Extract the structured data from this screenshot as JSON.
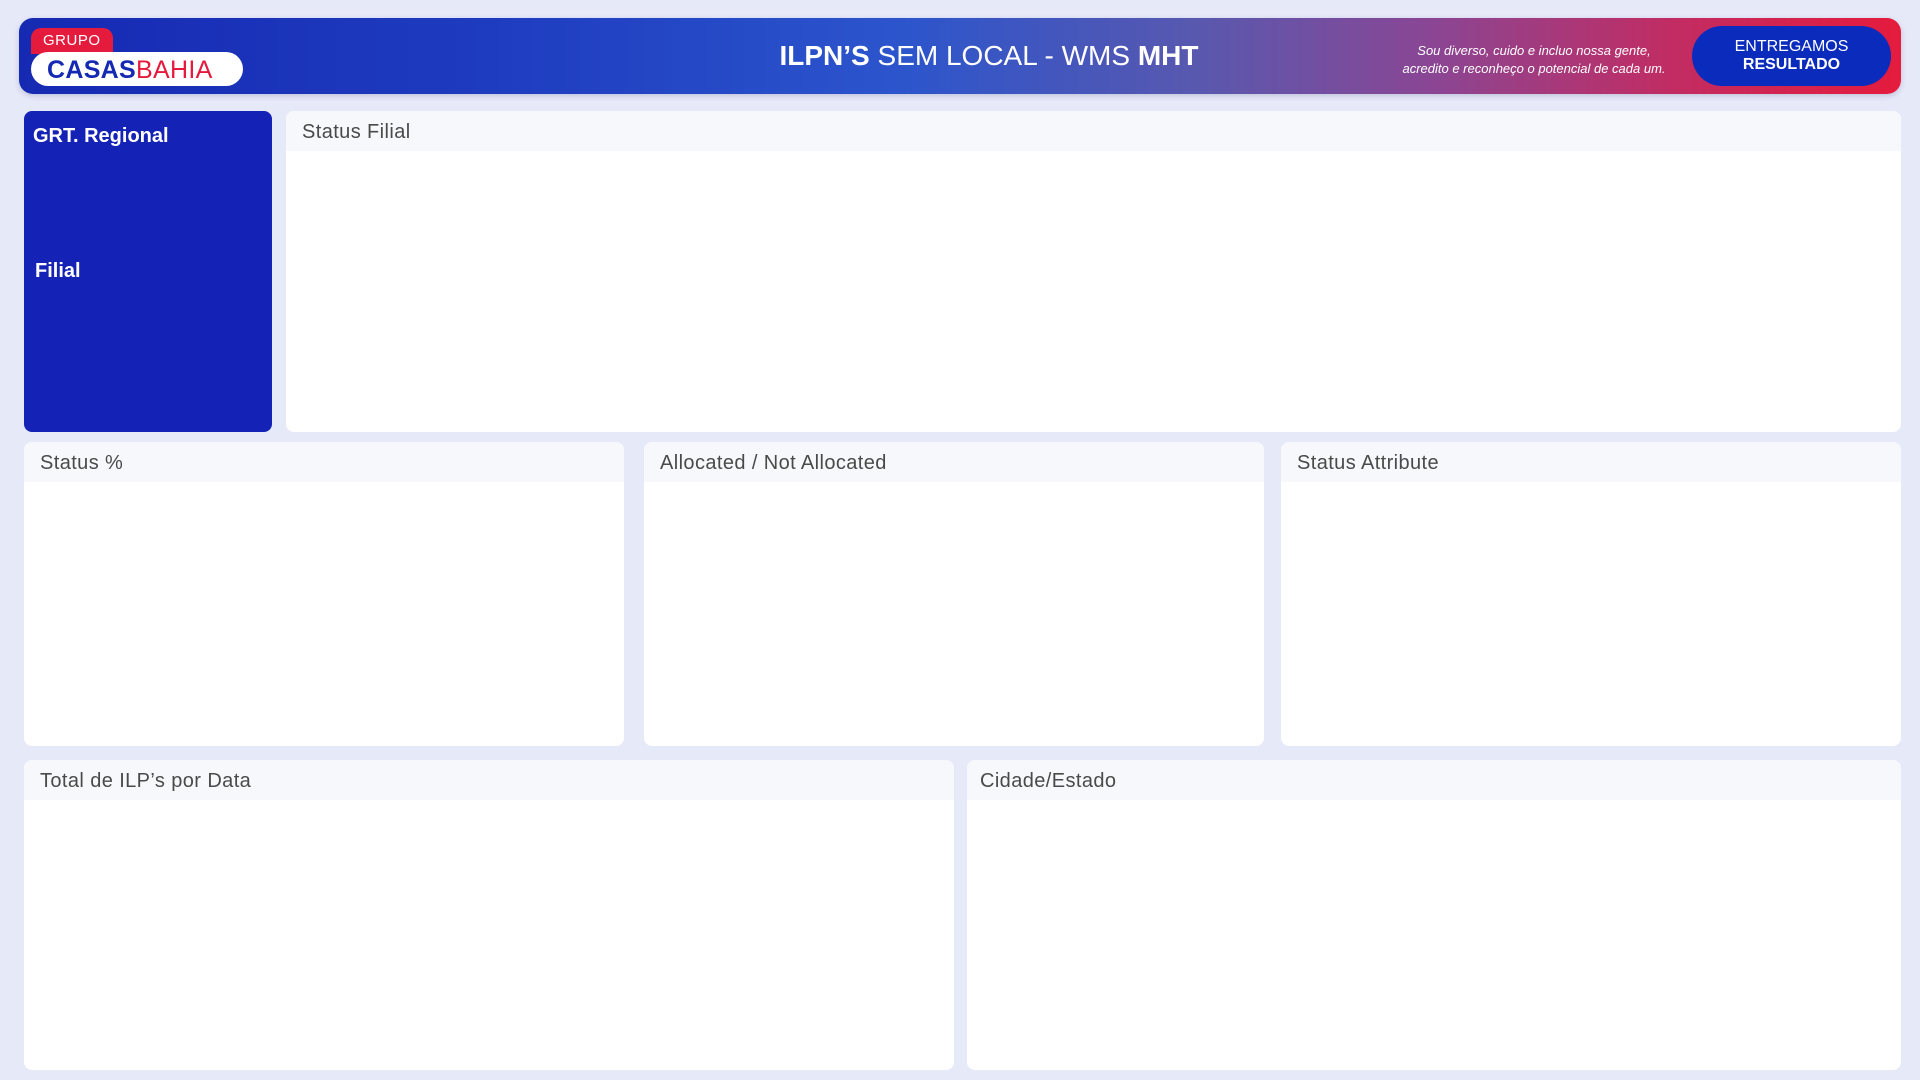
{
  "header": {
    "logo": {
      "tag": "GRUPO",
      "casas": "CASAS",
      "bahia": "BAHIA"
    },
    "title": {
      "part1_bold": "ILPN’S",
      "part2": " SEM LOCAL  - WMS ",
      "part3_bold": "MHT"
    },
    "motto": {
      "line1": "Sou diverso, cuido e incluo nossa gente,",
      "line2": "acredito e reconheço o potencial de cada um."
    },
    "badge": {
      "line1": "ENTREGAMOS",
      "line2": "RESULTADO"
    }
  },
  "filters": {
    "regional_label": "GRT. Regional",
    "filial_label": "Filial"
  },
  "cards": {
    "status_filial": "Status Filial",
    "status_pct": "Status %",
    "allocated": "Allocated / Not Allocated",
    "status_attribute": "Status Attribute",
    "total_por_data": "Total de ILP’s por Data",
    "cidade_estado": "Cidade/Estado"
  },
  "colors": {
    "brand_blue": "#1629b2",
    "brand_red": "#e51b3d",
    "filter_panel": "#1422b5",
    "background": "#e6e9f8"
  }
}
